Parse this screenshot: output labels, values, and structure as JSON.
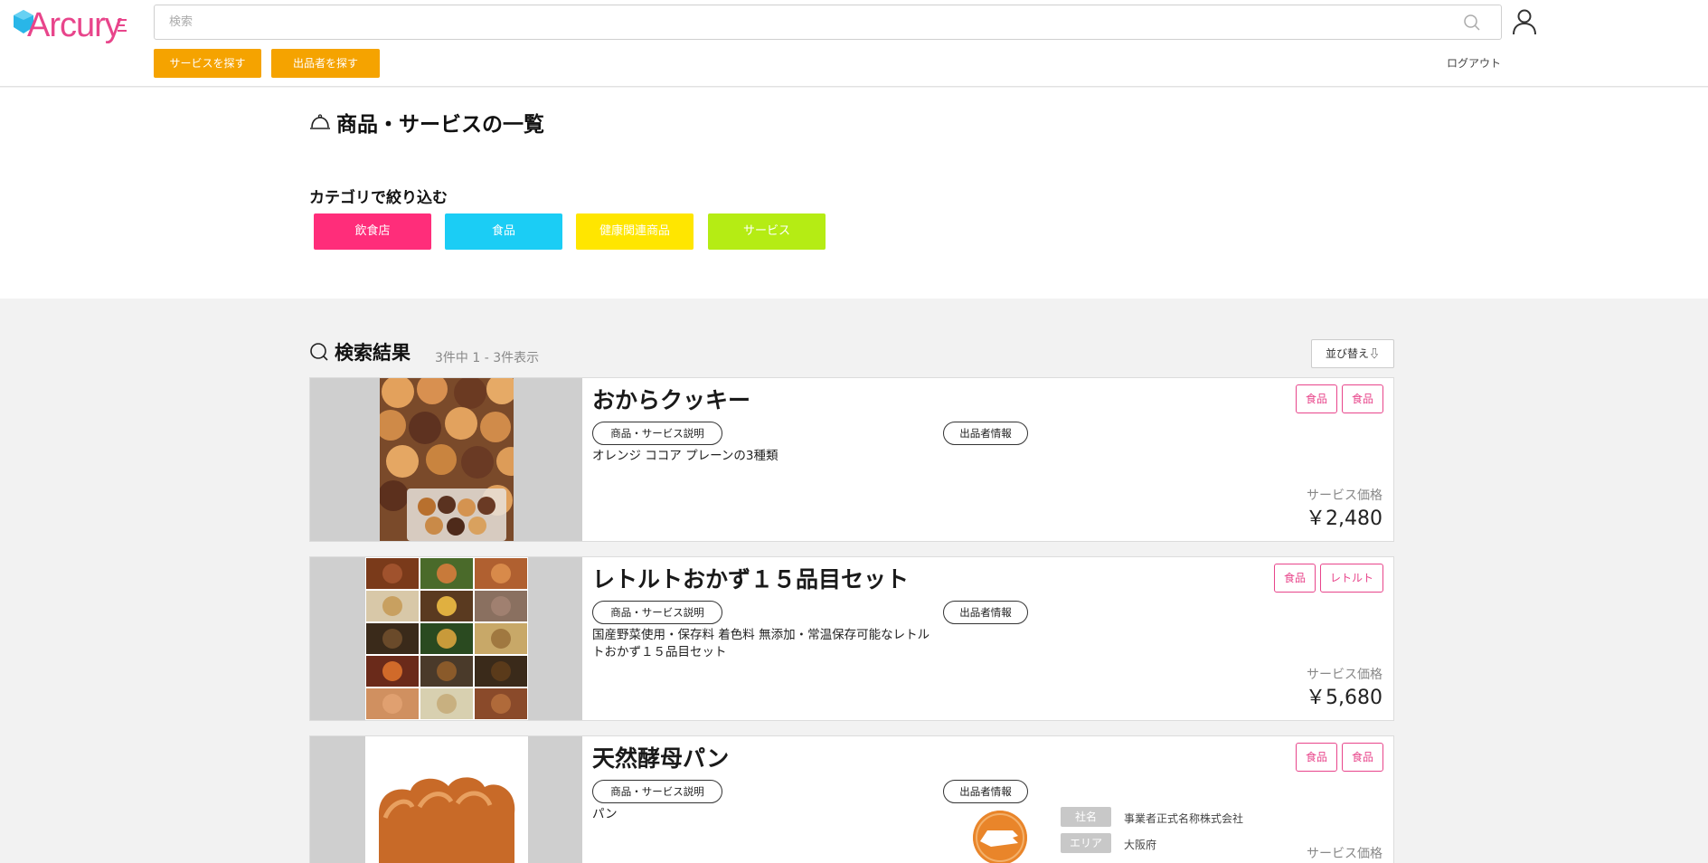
{
  "app": {
    "logo_text": "Arcury"
  },
  "header": {
    "search_placeholder": "検索",
    "find_service_label": "サービスを探す",
    "find_seller_label": "出品者を探す",
    "logout_label": "ログアウト"
  },
  "page": {
    "title": "商品・サービスの一覧",
    "filter_label": "カテゴリで絞り込む",
    "categories": [
      {
        "label": "飲食店",
        "color": "#ff2d7a"
      },
      {
        "label": "食品",
        "color": "#1bcdf5"
      },
      {
        "label": "健康関連商品",
        "color": "#ffe600"
      },
      {
        "label": "サービス",
        "color": "#b5ec14"
      }
    ]
  },
  "results": {
    "title": "検索結果",
    "count": "3件中 1 - 3件表示",
    "sort_label": "並び替え⇩"
  },
  "labels": {
    "desc_pill": "商品・サービス説明",
    "seller_pill": "出品者情報",
    "price_label": "サービス価格"
  },
  "products": [
    {
      "title": "おからクッキー",
      "description": "オレンジ ココア プレーンの3種類",
      "tags": [
        "食品",
        "食品"
      ],
      "price": "￥2,480",
      "image": "cookies"
    },
    {
      "title": "レトルトおかず１５品目セット",
      "description": "国産野菜使用・保存料 着色料 無添加・常温保存可能なレトルトおかず１５品目セット",
      "tags": [
        "食品",
        "レトルト"
      ],
      "price": "￥5,680",
      "image": "side-dishes"
    },
    {
      "title": "天然酵母パン",
      "description": "パン",
      "tags": [
        "食品",
        "食品"
      ],
      "price": "",
      "image": "bread",
      "seller": {
        "company_label": "社名",
        "company": "事業者正式名称株式会社",
        "area_label": "エリア",
        "area": "大阪府"
      }
    }
  ],
  "colors": {
    "accent": "#f5a300",
    "brand": "#e8458b"
  }
}
